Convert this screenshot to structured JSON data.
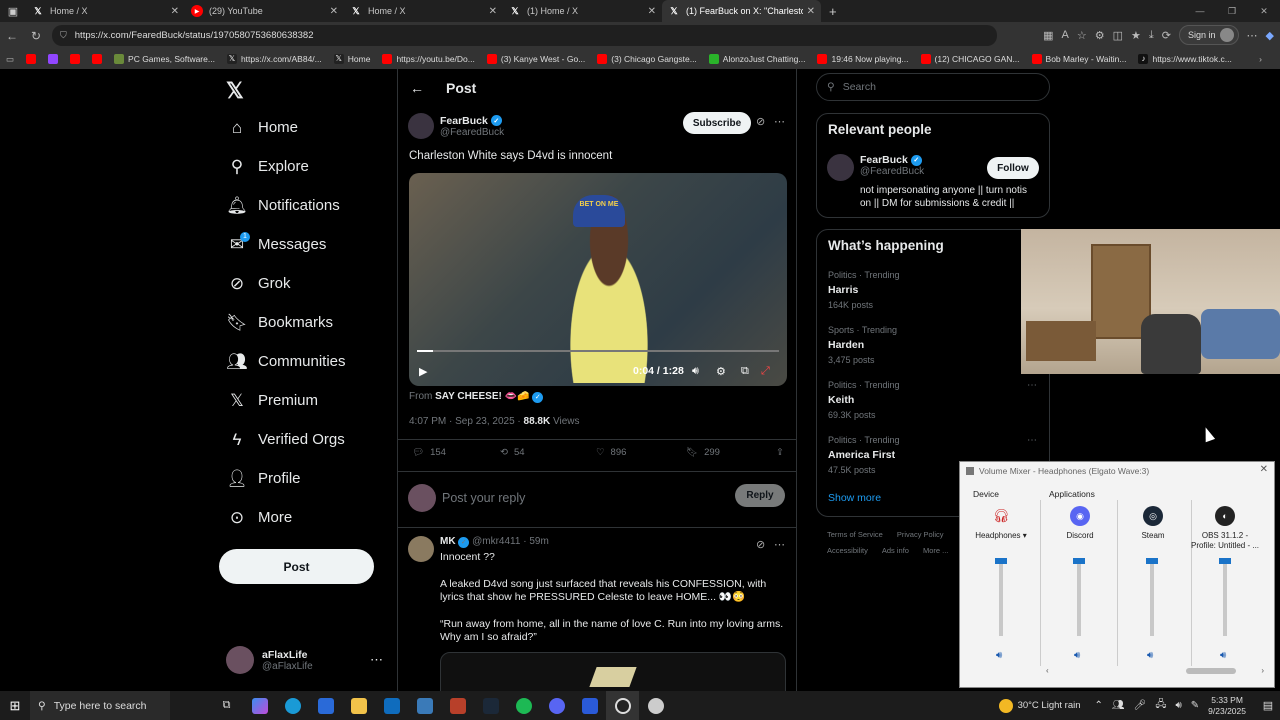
{
  "browser": {
    "tabs": [
      {
        "title": "Home / X",
        "icon": "x-icon"
      },
      {
        "title": "(29) YouTube",
        "icon": "youtube-icon"
      },
      {
        "title": "Home / X",
        "icon": "x-icon"
      },
      {
        "title": "(1) Home / X",
        "icon": "x-icon"
      },
      {
        "title": "(1) FearBuck on X: \"Charleston Wh",
        "icon": "x-icon"
      }
    ],
    "url": "https://x.com/FearedBuck/status/1970580753680638382",
    "sign_in": "Sign in",
    "bookmarks": [
      {
        "label": "PC Games, Software...",
        "color": "#6a8a3a"
      },
      {
        "label": "https://x.com/AB84/...",
        "color": "#ffffff"
      },
      {
        "label": "Home",
        "color": "#ffffff"
      },
      {
        "label": "https://youtu.be/Do...",
        "color": "#ff0000"
      },
      {
        "label": "(3) Kanye West - Go...",
        "color": "#ff0000"
      },
      {
        "label": "(3) Chicago Gangste...",
        "color": "#ff0000"
      },
      {
        "label": "AlonzoJust Chatting...",
        "color": "#2ab32a"
      },
      {
        "label": "19:46 Now playing...",
        "color": "#ff0000"
      },
      {
        "label": "(12) CHICAGO GAN...",
        "color": "#ff0000"
      },
      {
        "label": "Bob Marley - Waitin...",
        "color": "#ff0000"
      },
      {
        "label": "https://www.tiktok.c...",
        "color": "#ffffff"
      }
    ]
  },
  "nav": {
    "items": [
      {
        "label": "Home",
        "icon": "home-icon"
      },
      {
        "label": "Explore",
        "icon": "search-icon"
      },
      {
        "label": "Notifications",
        "icon": "bell-icon"
      },
      {
        "label": "Messages",
        "icon": "mail-icon"
      },
      {
        "label": "Grok",
        "icon": "grok-icon"
      },
      {
        "label": "Bookmarks",
        "icon": "bookmark-icon"
      },
      {
        "label": "Communities",
        "icon": "communities-icon"
      },
      {
        "label": "Premium",
        "icon": "x-icon"
      },
      {
        "label": "Verified Orgs",
        "icon": "lightning-icon"
      },
      {
        "label": "Profile",
        "icon": "person-icon"
      },
      {
        "label": "More",
        "icon": "more-circle-icon"
      }
    ],
    "messages_badge": "1",
    "post_button": "Post",
    "account": {
      "name": "aFlaxLife",
      "handle": "@aFlaxLife"
    }
  },
  "post": {
    "header": "Post",
    "author_name": "FearBuck",
    "author_handle": "@FearedBuck",
    "subscribe": "Subscribe",
    "text": "Charleston White says D4vd is innocent",
    "video": {
      "time": "0:04 / 1:28",
      "progress": 0.045,
      "cap_text": "BET ON ME"
    },
    "from_label": "From",
    "from_source": "SAY CHEESE! 👄🧀",
    "time": "4:07 PM · Sep 23, 2025 ·",
    "views_count": "88.8K",
    "views_label": "Views",
    "stats": {
      "replies": "154",
      "reposts": "54",
      "likes": "896",
      "bookmarks": "299"
    },
    "reply_placeholder": "Post your reply",
    "reply_button": "Reply"
  },
  "comment": {
    "name": "MK",
    "handle": "@mkr4411",
    "time": "· 59m",
    "line1": "Innocent ??",
    "line2": "A leaked D4vd song just surfaced that reveals his CONFESSION, with lyrics that show he PRESSURED Celeste to leave HOME... 👀😳",
    "line3": "“Run away from home, all in the name of love C. Run into my loving arms. Why am I so afraid?”"
  },
  "right": {
    "search_placeholder": "Search",
    "relevant_title": "Relevant people",
    "relevant": {
      "name": "FearBuck",
      "handle": "@FearedBuck",
      "bio": "not impersonating anyone || turn notis on || DM for submissions & credit ||",
      "follow": "Follow"
    },
    "happening_title": "What’s happening",
    "trends": [
      {
        "category": "Politics · Trending",
        "name": "Harris",
        "count": "164K posts"
      },
      {
        "category": "Sports · Trending",
        "name": "Harden",
        "count": "3,475 posts"
      },
      {
        "category": "Politics · Trending",
        "name": "Keith",
        "count": "69.3K posts"
      },
      {
        "category": "Politics · Trending",
        "name": "America First",
        "count": "47.5K posts"
      }
    ],
    "show_more": "Show more",
    "footer1": [
      "Terms of Service",
      "Privacy Policy"
    ],
    "footer2": [
      "Accessibility",
      "Ads info",
      "More ..."
    ]
  },
  "mixer": {
    "title": "Volume Mixer - Headphones (Elgato Wave:3)",
    "device_label": "Device",
    "apps_label": "Applications",
    "channels": [
      {
        "name": "Headphones ▾",
        "icon": "headphones-icon",
        "level": 1.0
      },
      {
        "name": "Discord",
        "icon": "discord-icon",
        "level": 1.0
      },
      {
        "name": "Steam",
        "icon": "steam-icon",
        "level": 1.0
      },
      {
        "name": "OBS 31.1.2 - Profile: Untitled - ...",
        "icon": "obs-icon",
        "level": 1.0
      }
    ]
  },
  "taskbar": {
    "search_placeholder": "Type here to search",
    "weather": "30°C  Light rain",
    "time": "5:33 PM",
    "date": "9/23/2025"
  }
}
